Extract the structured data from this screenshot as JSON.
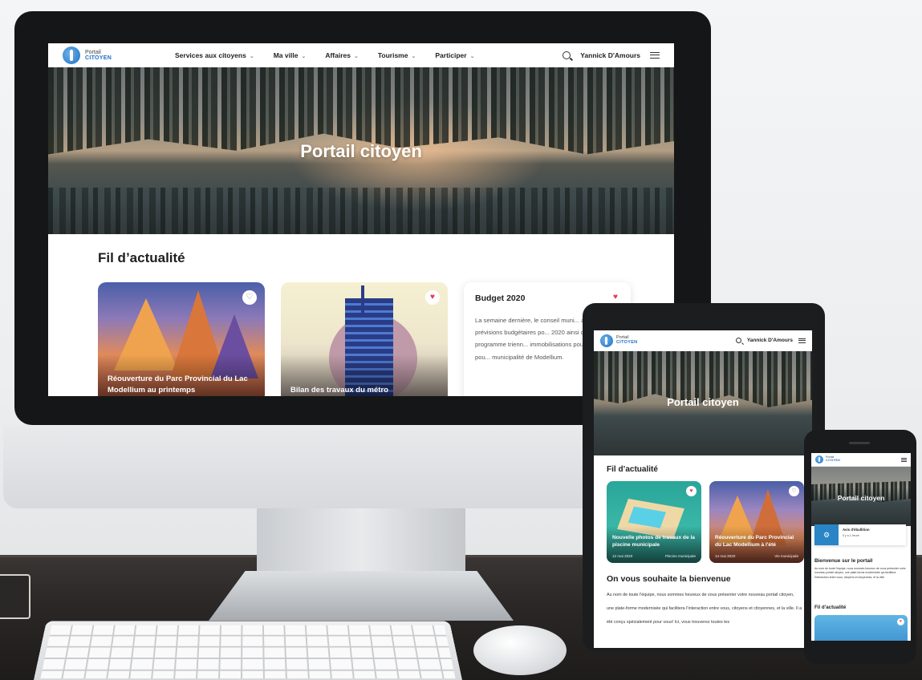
{
  "desktop": {
    "logo": {
      "line1": "Portail",
      "line2": "CITOYEN"
    },
    "menu": [
      {
        "label": "Services aux citoyens",
        "chevron": "⌄"
      },
      {
        "label": "Ma ville",
        "chevron": "⌄"
      },
      {
        "label": "Affaires",
        "chevron": "⌄"
      },
      {
        "label": "Tourisme",
        "chevron": "⌄"
      },
      {
        "label": "Participer",
        "chevron": "⌄"
      }
    ],
    "user_name": "Yannick D'Amours",
    "hero_title": "Portail citoyen",
    "feed_title": "Fil d’actualité",
    "cards": [
      {
        "title": "Réouverture du Parc Provincial du Lac Modellium au printemps",
        "liked": false,
        "heart": "♡"
      },
      {
        "title": "Bilan des travaux du métro",
        "liked": true,
        "heart": "♥"
      },
      {
        "title": "Budget 2020",
        "text": "La semaine dernière, le conseil muni... adopté les prévisions budgétaires po... 2020 ainsi que le programme trienn... immobilisations pour la Ville et pou... municipalité de Modellium.",
        "liked": true,
        "heart": "♥"
      }
    ]
  },
  "tablet": {
    "logo": {
      "line1": "Portail",
      "line2": "CITOYEN"
    },
    "user_name": "Yannick D'Amours",
    "hero_title": "Portail citoyen",
    "feed_title": "Fil d’actualité",
    "cards": [
      {
        "title": "Nouvelle photos de travaux de la piscine municipale",
        "date": "12 mai 2020",
        "category": "Piscine municipale",
        "heart": "♥"
      },
      {
        "title": "Réouverture du Parc Provincial du Lac Modellium à l'été",
        "date": "14 mai 2020",
        "category": "Vie municipale",
        "heart": "♡"
      }
    ],
    "welcome_title": "On vous souhaite la bienvenue",
    "welcome_text": "Au nom de toute l'équipe, nous sommes heureux de vous présenter votre nouveau portail citoyen, une plate-forme modernisée qui facilitera l'interaction entre vous, citoyens et citoyennes, et la ville. Il a été conçu spécialement pour vous! Ici, vous trouverez toutes les"
  },
  "phone": {
    "logo": {
      "line1": "Portail",
      "line2": "CITOYEN"
    },
    "hero_title": "Portail citoyen",
    "alert": {
      "title": "Avis d'ébullition",
      "time": "Il y a 1 heure"
    },
    "welcome_title": "Bienvenue sur le portail",
    "welcome_text": "Au nom de toute l'équipe, nous sommes heureux de vous présenter votre nouveau portail citoyen, une plate-forme modernisée qui facilitera l'interaction entre vous, citoyens et citoyennes, et la ville.",
    "feed_title": "Fil d'actualité",
    "heart": "♥"
  },
  "colors": {
    "brand": "#1d6fc2",
    "heart": "#e53950",
    "alert": "#2a85c6"
  }
}
